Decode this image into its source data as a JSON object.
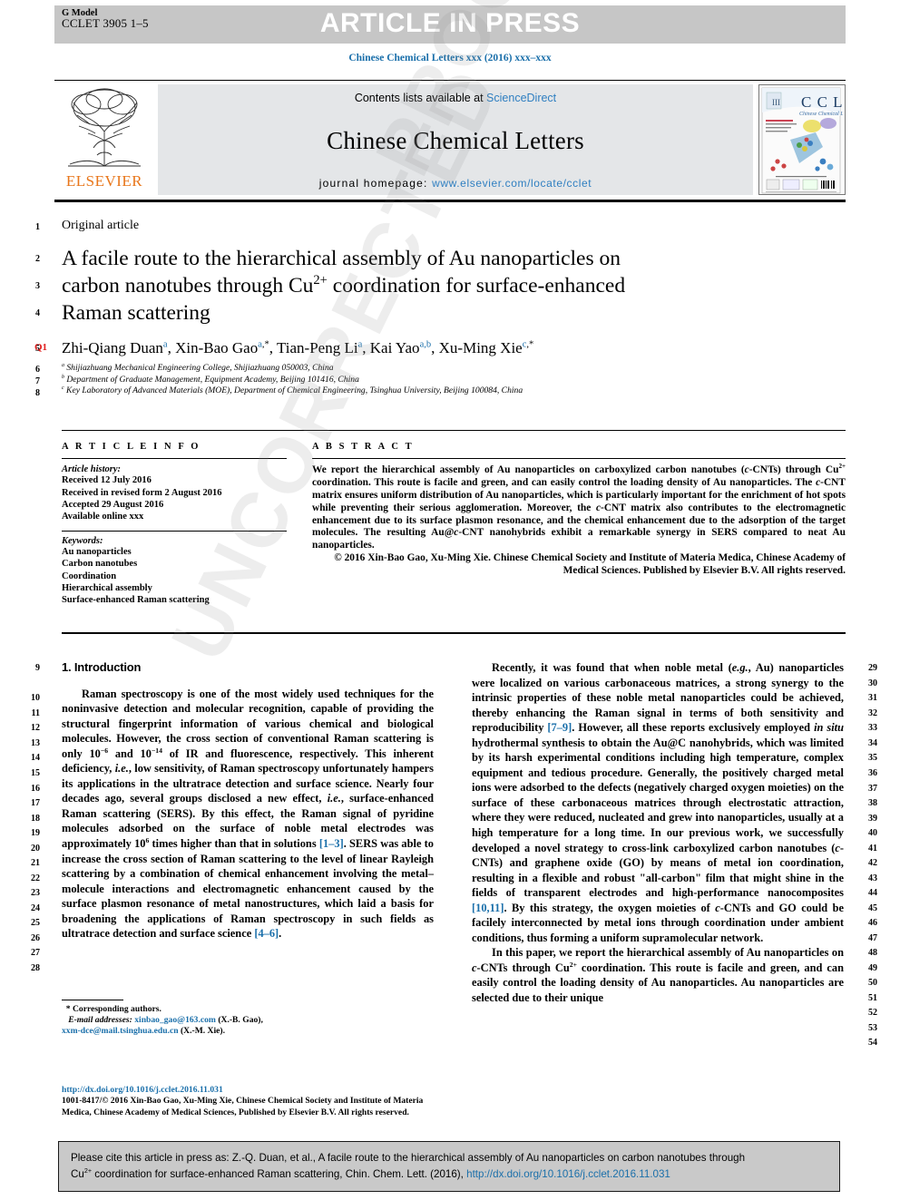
{
  "header": {
    "g_model_label": "G Model",
    "article_id": "CCLET 3905 1–5",
    "article_in_press": "ARTICLE IN PRESS",
    "journal_running_head": "Chinese Chemical Letters xxx (2016) xxx–xxx"
  },
  "masthead": {
    "publisher": "ELSEVIER",
    "contents_prefix": "Contents lists available at ",
    "contents_link": "ScienceDirect",
    "journal_title": "Chinese Chemical Letters",
    "homepage_prefix": "journal homepage: ",
    "homepage_url": "www.elsevier.com/locate/cclet",
    "cover_badge": "CCL",
    "cover_subtitle": "Chinese Chemical Letters"
  },
  "article": {
    "type_label": "Original article",
    "query_marker": "Q1",
    "title_line1": "A facile route to the hierarchical assembly of Au nanoparticles on",
    "title_line2_a": "carbon nanotubes through Cu",
    "title_line2_sup": "2+",
    "title_line2_b": " coordination for surface-enhanced",
    "title_line3": "Raman scattering",
    "authors": [
      {
        "name": "Zhi-Qiang Duan",
        "sup": "a",
        "star": false
      },
      {
        "name": "Xin-Bao Gao",
        "sup": "a",
        "star": true
      },
      {
        "name": "Tian-Peng Li",
        "sup": "a",
        "star": false
      },
      {
        "name": "Kai Yao",
        "sup": "a,b",
        "star": false
      },
      {
        "name": "Xu-Ming Xie",
        "sup": "c",
        "star": true
      }
    ],
    "affiliations": [
      {
        "marker": "a",
        "text": "Shijiazhuang Mechanical Engineering College, Shijiazhuang 050003, China"
      },
      {
        "marker": "b",
        "text": "Department of Graduate Management, Equipment Academy, Beijing 101416, China"
      },
      {
        "marker": "c",
        "text": "Key Laboratory of Advanced Materials (MOE), Department of Chemical Engineering, Tsinghua University, Beijing 100084, China"
      }
    ]
  },
  "article_info": {
    "heading": "A R T I C L E   I N F O",
    "history_heading": "Article history:",
    "history": [
      "Received 12 July 2016",
      "Received in revised form 2 August 2016",
      "Accepted 29 August 2016",
      "Available online xxx"
    ],
    "keywords_heading": "Keywords:",
    "keywords": [
      "Au nanoparticles",
      "Carbon nanotubes",
      "Coordination",
      "Hierarchical assembly",
      "Surface-enhanced Raman scattering"
    ]
  },
  "abstract": {
    "heading": "A B S T R A C T",
    "body_part1": "We report the hierarchical assembly of Au nanoparticles on carboxylized carbon nanotubes (",
    "body_em1": "c",
    "body_part2": "-CNTs) through Cu",
    "body_sup1": "2+",
    "body_part3": " coordination. This route is facile and green, and can easily control the loading density of Au nanoparticles. The ",
    "body_em2": "c",
    "body_part4": "-CNT matrix ensures uniform distribution of Au nanoparticles, which is particularly important for the enrichment of hot spots while preventing their serious agglomeration. Moreover, the ",
    "body_em3": "c",
    "body_part5": "-CNT matrix also contributes to the electromagnetic enhancement due to its surface plasmon resonance, and the chemical enhancement due to the adsorption of the target molecules. The resulting Au@",
    "body_em4": "c",
    "body_part6": "-CNT nanohybrids exhibit a remarkable synergy in SERS compared to neat Au nanoparticles.",
    "copyright": "© 2016 Xin-Bao Gao, Xu-Ming Xie. Chinese Chemical Society and Institute of Materia Medica, Chinese Academy of Medical Sciences. Published by Elsevier B.V. All rights reserved."
  },
  "body": {
    "section_heading": "1. Introduction",
    "left_para1_a": "Raman spectroscopy is one of the most widely used techniques for the noninvasive detection and molecular recognition, capable of providing the structural fingerprint information of various chemical and biological molecules. However, the cross section of conventional Raman scattering is only 10",
    "left_para1_sup1": "−6",
    "left_para1_b": " and 10",
    "left_para1_sup2": "−14",
    "left_para1_c": " of IR and fluorescence, respectively. This inherent deficiency, ",
    "left_para1_em1": "i.e.",
    "left_para1_d": ", low sensitivity, of Raman spectroscopy unfortunately hampers its applications in the ultratrace detection and surface science. Nearly four decades ago, several groups disclosed a new effect, ",
    "left_para1_em2": "i.e.",
    "left_para1_e": ", surface-enhanced Raman scattering (SERS). By this effect, the Raman signal of pyridine molecules adsorbed on the surface of noble metal electrodes was approximately 10",
    "left_para1_sup3": "6",
    "left_para1_f": " times higher than that in solutions ",
    "left_para1_ref1": "[1–3]",
    "left_para1_g": ". SERS was able to increase the cross section of Raman scattering to the level of linear Rayleigh scattering by a combination of chemical enhancement involving the metal–molecule interactions and electromagnetic enhancement caused by the surface plasmon resonance of metal nanostructures, which laid a basis for broadening the applications of Raman spectroscopy in such fields as ultratrace detection and surface science ",
    "left_para1_ref2": "[4–6]",
    "left_para1_h": ".",
    "right_para1_a": "Recently, it was found that when noble metal (",
    "right_para1_em1": "e.g.",
    "right_para1_b": ", Au) nanoparticles were localized on various carbonaceous matrices, a strong synergy to the intrinsic properties of these noble metal nanoparticles could be achieved, thereby enhancing the Raman signal in terms of both sensitivity and reproducibility ",
    "right_para1_ref1": "[7–9]",
    "right_para1_c": ". However, all these reports exclusively employed ",
    "right_para1_em2": "in situ",
    "right_para1_d": " hydrothermal synthesis to obtain the Au@C nanohybrids, which was limited by its harsh experimental conditions including high temperature, complex equipment and tedious procedure. Generally, the positively charged metal ions were adsorbed to the defects (negatively charged oxygen moieties) on the surface of these carbonaceous matrices through electrostatic attraction, where they were reduced, nucleated and grew into nanoparticles, usually at a high temperature for a long time. In our previous work, we successfully developed a novel strategy to cross-link carboxylized carbon nanotubes (",
    "right_para1_em3": "c",
    "right_para1_e": "-CNTs) and graphene oxide (GO) by means of metal ion coordination, resulting in a flexible and robust \"all-carbon\" film that might shine in the fields of transparent electrodes and high-performance nanocomposites ",
    "right_para1_ref2": "[10,11]",
    "right_para1_f": ". By this strategy, the oxygen moieties of ",
    "right_para1_em4": "c",
    "right_para1_g": "-CNTs and GO could be facilely interconnected by metal ions through coordination under ambient conditions, thus forming a uniform supramolecular network.",
    "right_para2_a": "In this paper, we report the hierarchical assembly of Au nanoparticles on ",
    "right_para2_em1": "c",
    "right_para2_b": "-CNTs through Cu",
    "right_para2_sup1": "2+",
    "right_para2_c": " coordination. This route is facile and green, and can easily control the loading density of Au nanoparticles. Au nanoparticles are selected due to their unique"
  },
  "footnotes": {
    "star": "*",
    "corresponding": "Corresponding authors.",
    "email_label": "E-mail addresses:",
    "email1": "xinbao_gao@163.com",
    "email1_who": " (X.-B. Gao),",
    "email2": "xxm-dce@mail.tsinghua.edu.cn",
    "email2_who": " (X.-M. Xie)."
  },
  "doi_block": {
    "doi_url": "http://dx.doi.org/10.1016/j.cclet.2016.11.031",
    "issn_copyright": "1001-8417/© 2016 Xin-Bao Gao, Xu-Ming Xie, Chinese Chemical Society and Institute of Materia Medica, Chinese Academy of Medical Sciences, Published by Elsevier B.V. All rights reserved."
  },
  "cite_box": {
    "line1": "Please cite this article in press as: Z.-Q. Duan, et al., A facile route to the hierarchical assembly of Au nanoparticles on carbon nanotubes through",
    "line2_a": "Cu",
    "line2_sup": "2+",
    "line2_b": " coordination for surface-enhanced Raman scattering, Chin. Chem. Lett. (2016), ",
    "line2_link": "http://dx.doi.org/10.1016/j.cclet.2016.11.031"
  },
  "line_numbers": {
    "left": [
      "1",
      "2",
      "3",
      "4",
      "5",
      "6",
      "7",
      "8"
    ],
    "left_body": [
      "9",
      "10",
      "11",
      "12",
      "13",
      "14",
      "15",
      "16",
      "17",
      "18",
      "19",
      "20",
      "21",
      "22",
      "23",
      "24",
      "25",
      "26",
      "27",
      "28"
    ],
    "right_body": [
      "29",
      "30",
      "31",
      "32",
      "33",
      "34",
      "35",
      "36",
      "37",
      "38",
      "39",
      "40",
      "41",
      "42",
      "43",
      "44",
      "45",
      "46",
      "47",
      "48",
      "49",
      "50",
      "51",
      "52",
      "53",
      "54"
    ]
  },
  "watermark": {
    "text1": "PROOF",
    "text2": "UNCORRECTED"
  },
  "colors": {
    "link_blue": "#1a6faa",
    "elsevier_orange": "#e8761a",
    "q1_red": "#e01b1b",
    "grey_bar": "#c6c6c6",
    "masthead_grey": "#e4e6e8",
    "cite_grey": "#c9c9c9"
  }
}
